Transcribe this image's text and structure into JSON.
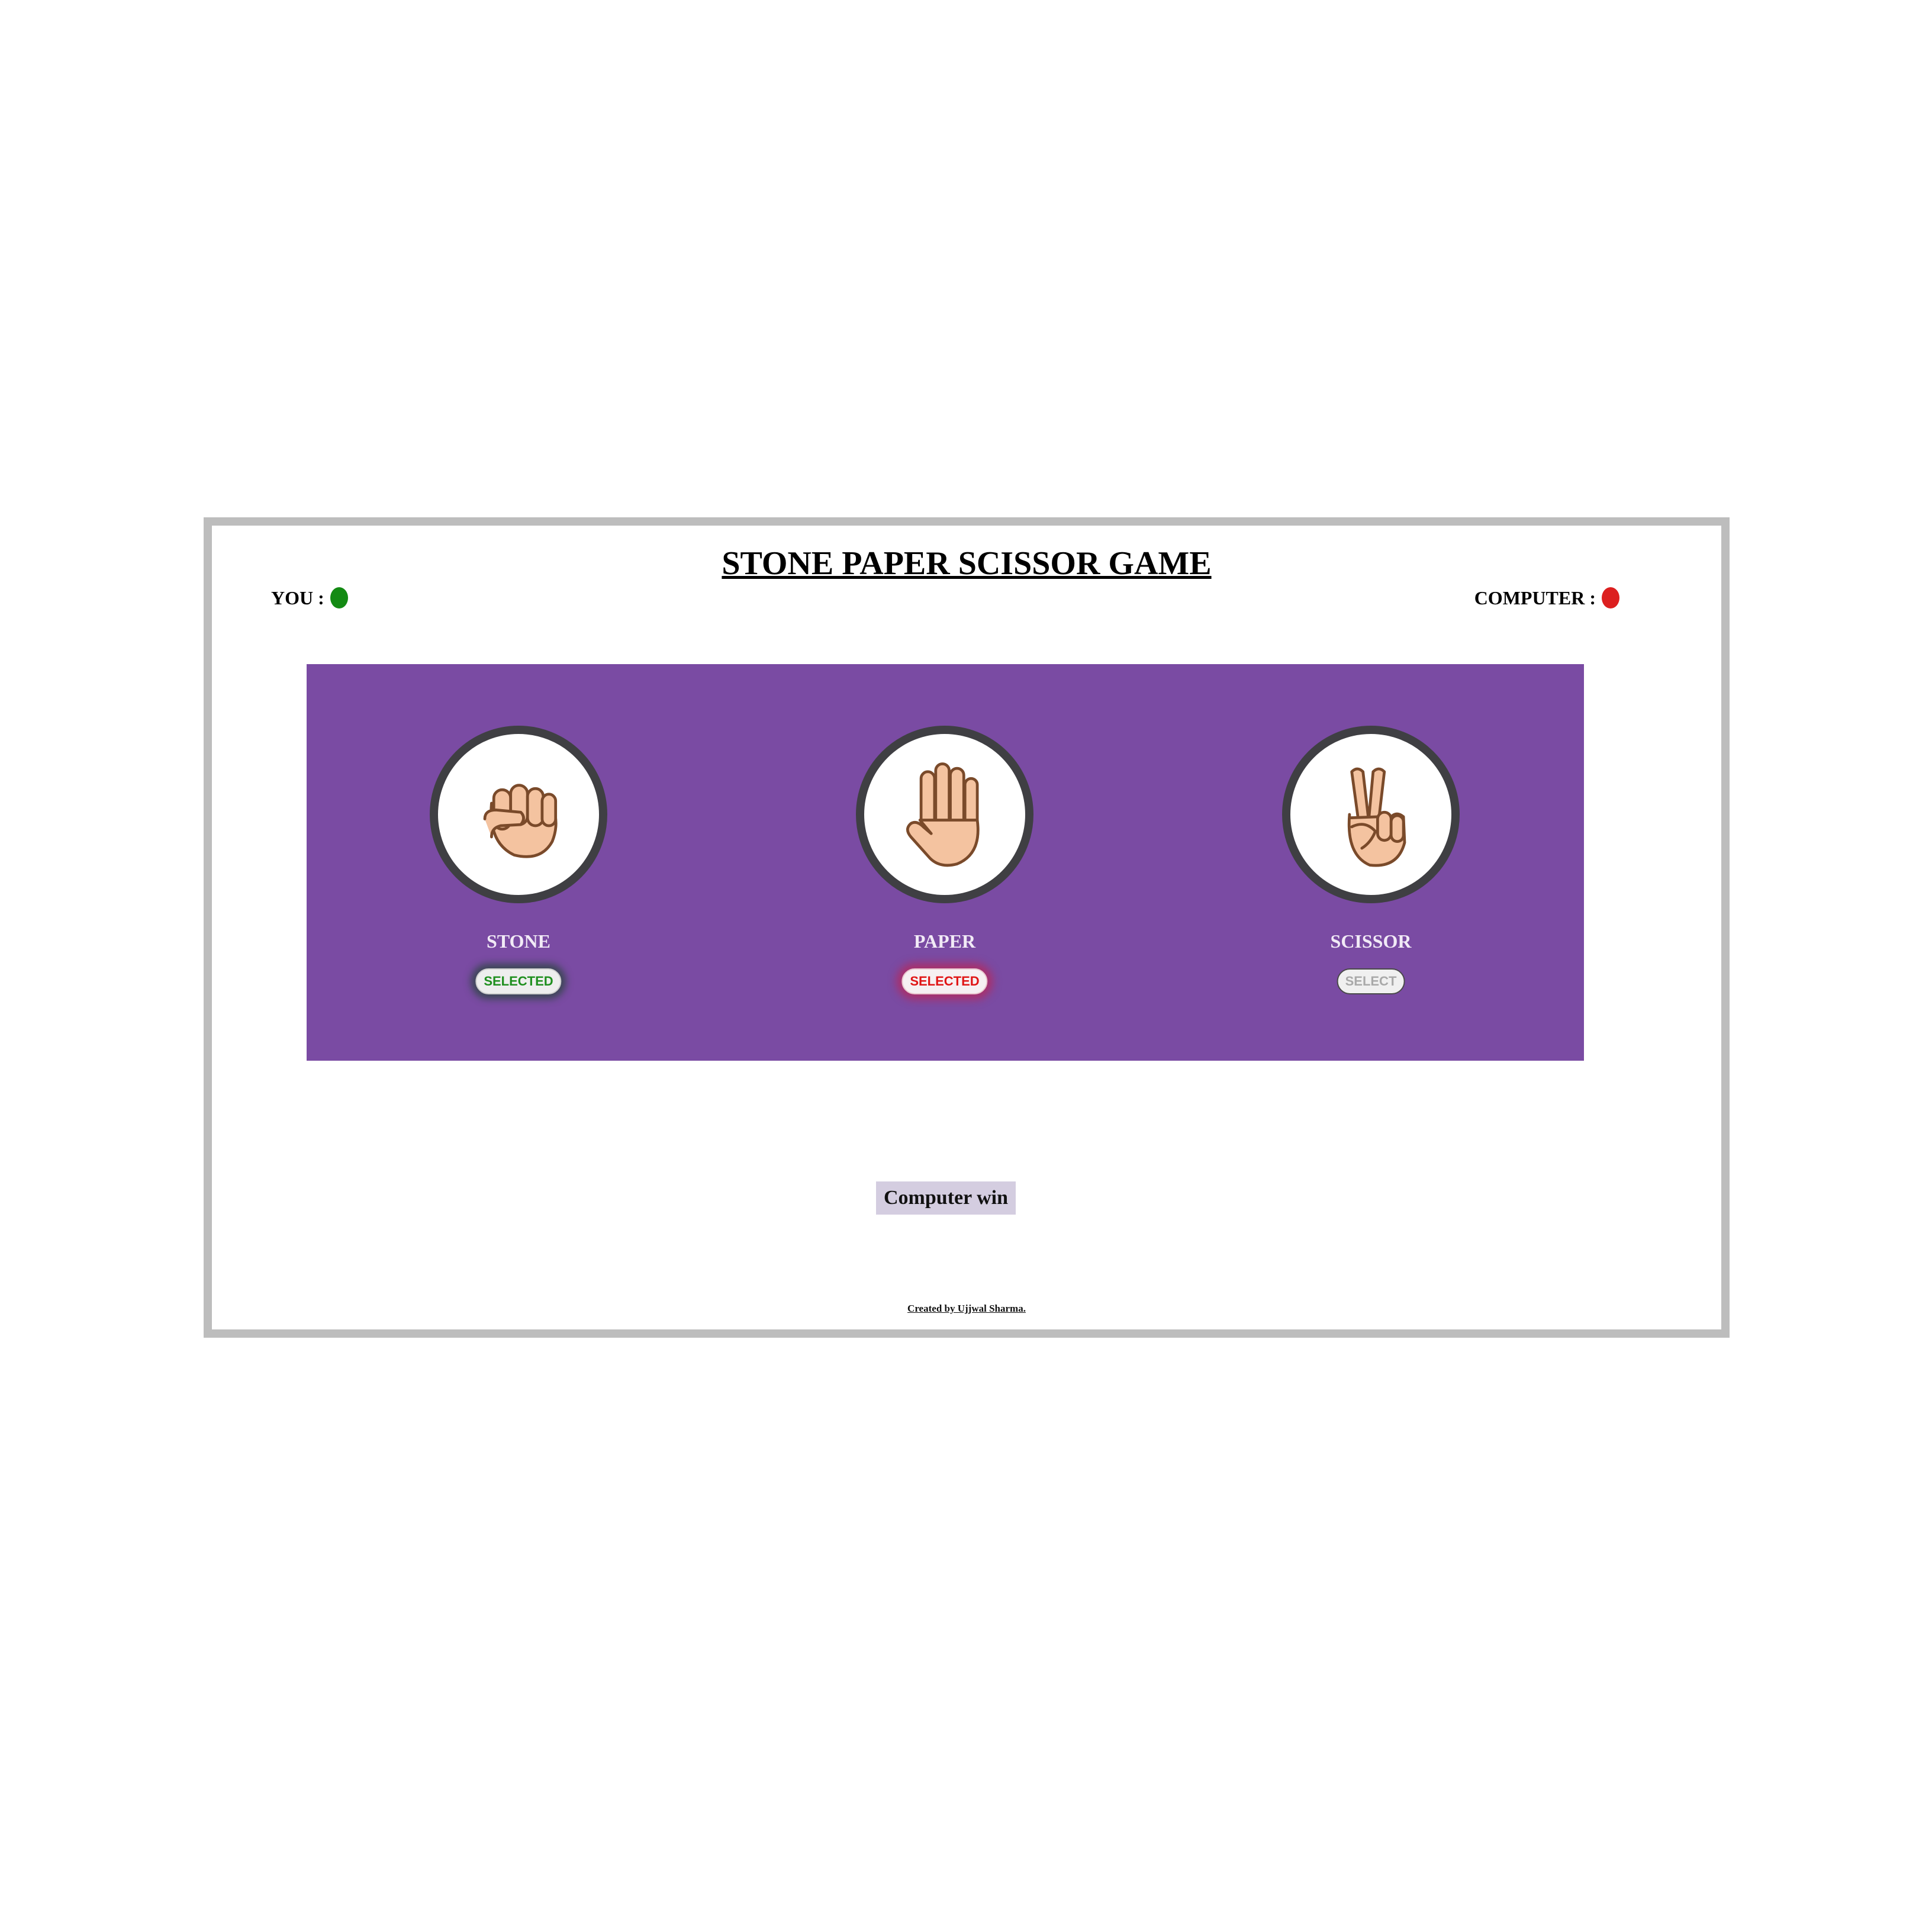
{
  "header": {
    "title": "STONE PAPER SCISSOR GAME",
    "you_label": "YOU :",
    "computer_label": "COMPUTER :",
    "you_indicator_color": "#138a13",
    "computer_indicator_color": "#dc1f1f"
  },
  "choices": [
    {
      "label": "STONE",
      "button": "SELECTED",
      "button_state": "player-selected",
      "icon": "fist-hand-icon"
    },
    {
      "label": "PAPER",
      "button": "SELECTED",
      "button_state": "computer-selected",
      "icon": "open-hand-icon"
    },
    {
      "label": "SCISSOR",
      "button": "SELECT",
      "button_state": "unselected",
      "icon": "victory-hand-icon"
    }
  ],
  "result": {
    "text": "Computer win"
  },
  "footer": {
    "credit": "Created by Ujjwal Sharma."
  },
  "colors": {
    "panel": "#7a4ba3",
    "frame_border": "#bdbdbd",
    "skin": "#f4c3a0",
    "outline": "#7a4a2a"
  }
}
